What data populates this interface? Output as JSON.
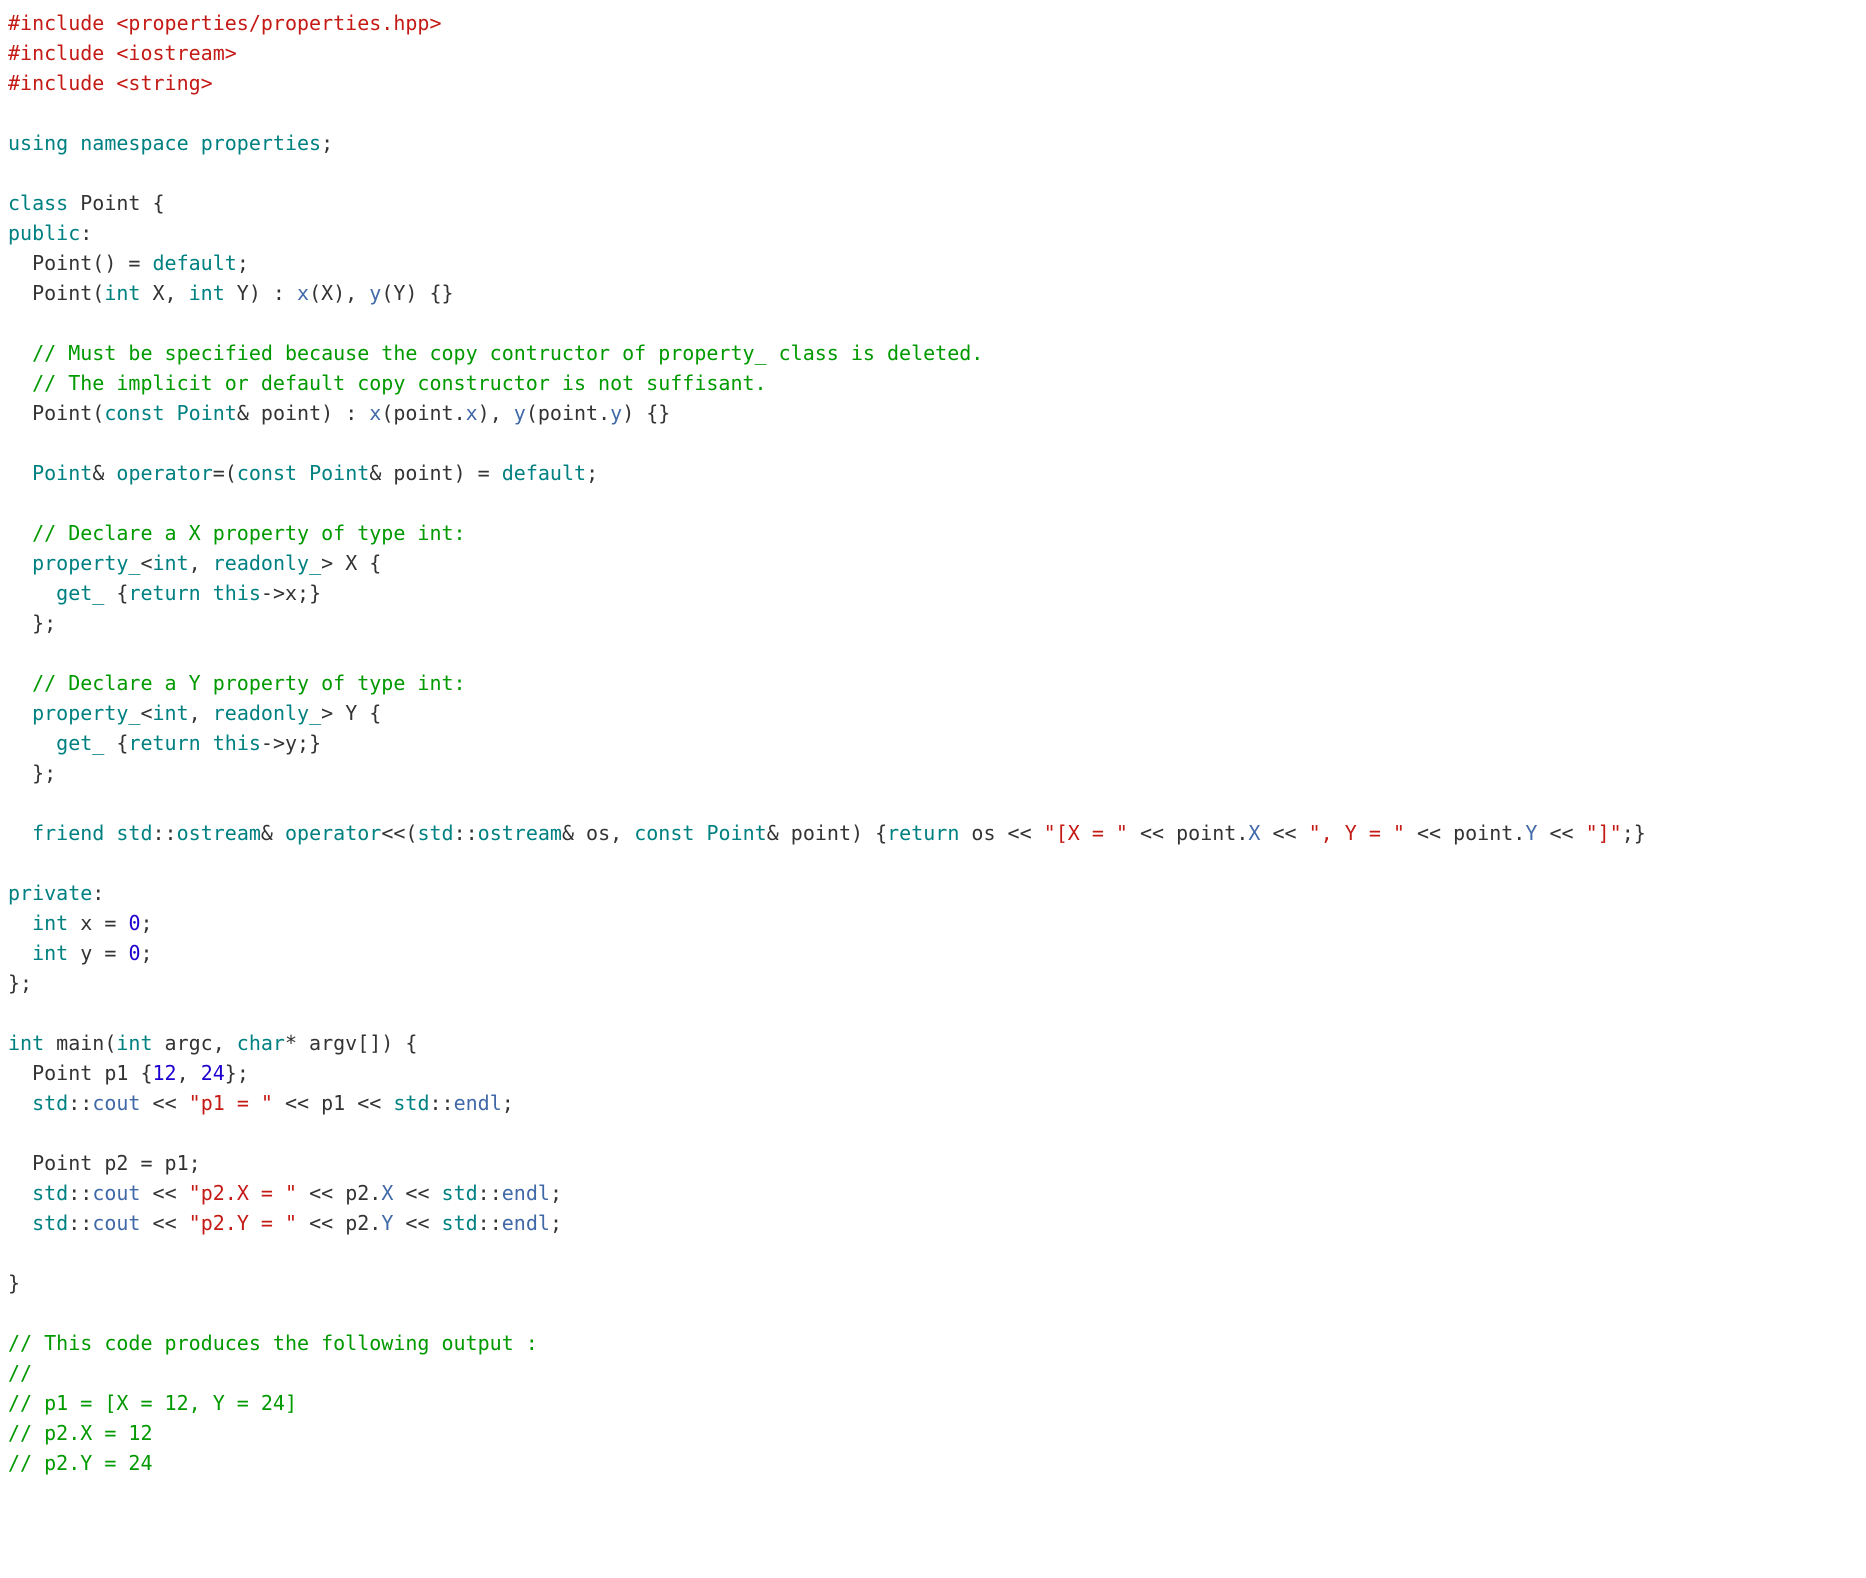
{
  "code_lines": [
    {
      "indent": 0,
      "tokens": [
        {
          "t": "#include ",
          "c": "preproc"
        },
        {
          "t": "<properties/properties.hpp>",
          "c": "preproc"
        }
      ]
    },
    {
      "indent": 0,
      "tokens": [
        {
          "t": "#include ",
          "c": "preproc"
        },
        {
          "t": "<iostream>",
          "c": "preproc"
        }
      ]
    },
    {
      "indent": 0,
      "tokens": [
        {
          "t": "#include ",
          "c": "preproc"
        },
        {
          "t": "<string>",
          "c": "preproc"
        }
      ]
    },
    {
      "indent": 0,
      "tokens": []
    },
    {
      "indent": 0,
      "tokens": [
        {
          "t": "using",
          "c": "keyword"
        },
        {
          "t": " ",
          "c": "plain"
        },
        {
          "t": "namespace",
          "c": "keyword"
        },
        {
          "t": " ",
          "c": "plain"
        },
        {
          "t": "properties",
          "c": "usertype"
        },
        {
          "t": ";",
          "c": "punct"
        }
      ]
    },
    {
      "indent": 0,
      "tokens": []
    },
    {
      "indent": 0,
      "tokens": [
        {
          "t": "class",
          "c": "keyword"
        },
        {
          "t": " ",
          "c": "plain"
        },
        {
          "t": "Point",
          "c": "plain"
        },
        {
          "t": " {",
          "c": "punct"
        }
      ]
    },
    {
      "indent": 0,
      "tokens": [
        {
          "t": "public",
          "c": "keyword"
        },
        {
          "t": ":",
          "c": "punct"
        }
      ]
    },
    {
      "indent": 1,
      "tokens": [
        {
          "t": "Point() = ",
          "c": "plain"
        },
        {
          "t": "default",
          "c": "keyword"
        },
        {
          "t": ";",
          "c": "punct"
        }
      ]
    },
    {
      "indent": 1,
      "tokens": [
        {
          "t": "Point(",
          "c": "plain"
        },
        {
          "t": "int",
          "c": "type"
        },
        {
          "t": " X, ",
          "c": "plain"
        },
        {
          "t": "int",
          "c": "type"
        },
        {
          "t": " Y) : ",
          "c": "plain"
        },
        {
          "t": "x",
          "c": "member"
        },
        {
          "t": "(X), ",
          "c": "plain"
        },
        {
          "t": "y",
          "c": "member"
        },
        {
          "t": "(Y) {}",
          "c": "plain"
        }
      ]
    },
    {
      "indent": 0,
      "tokens": []
    },
    {
      "indent": 1,
      "tokens": [
        {
          "t": "// Must be specified because the copy contructor of property_ class is deleted.",
          "c": "comment"
        }
      ]
    },
    {
      "indent": 1,
      "tokens": [
        {
          "t": "// The implicit or default copy constructor is not suffisant.",
          "c": "comment"
        }
      ]
    },
    {
      "indent": 1,
      "tokens": [
        {
          "t": "Point(",
          "c": "plain"
        },
        {
          "t": "const",
          "c": "keyword"
        },
        {
          "t": " ",
          "c": "plain"
        },
        {
          "t": "Point",
          "c": "usertype"
        },
        {
          "t": "& point) : ",
          "c": "plain"
        },
        {
          "t": "x",
          "c": "member"
        },
        {
          "t": "(point.",
          "c": "plain"
        },
        {
          "t": "x",
          "c": "member"
        },
        {
          "t": "), ",
          "c": "plain"
        },
        {
          "t": "y",
          "c": "member"
        },
        {
          "t": "(point.",
          "c": "plain"
        },
        {
          "t": "y",
          "c": "member"
        },
        {
          "t": ") {}",
          "c": "plain"
        }
      ]
    },
    {
      "indent": 0,
      "tokens": []
    },
    {
      "indent": 1,
      "tokens": [
        {
          "t": "Point",
          "c": "usertype"
        },
        {
          "t": "& ",
          "c": "plain"
        },
        {
          "t": "operator",
          "c": "keyword"
        },
        {
          "t": "=(",
          "c": "plain"
        },
        {
          "t": "const",
          "c": "keyword"
        },
        {
          "t": " ",
          "c": "plain"
        },
        {
          "t": "Point",
          "c": "usertype"
        },
        {
          "t": "& point) = ",
          "c": "plain"
        },
        {
          "t": "default",
          "c": "keyword"
        },
        {
          "t": ";",
          "c": "punct"
        }
      ]
    },
    {
      "indent": 0,
      "tokens": []
    },
    {
      "indent": 1,
      "tokens": [
        {
          "t": "// Declare a X property of type int:",
          "c": "comment"
        }
      ]
    },
    {
      "indent": 1,
      "tokens": [
        {
          "t": "property_",
          "c": "usertype"
        },
        {
          "t": "<",
          "c": "punct"
        },
        {
          "t": "int",
          "c": "type"
        },
        {
          "t": ", ",
          "c": "plain"
        },
        {
          "t": "readonly_",
          "c": "usertype"
        },
        {
          "t": "> X {",
          "c": "plain"
        }
      ]
    },
    {
      "indent": 2,
      "tokens": [
        {
          "t": "get_",
          "c": "usertype"
        },
        {
          "t": " {",
          "c": "plain"
        },
        {
          "t": "return",
          "c": "keyword"
        },
        {
          "t": " ",
          "c": "plain"
        },
        {
          "t": "this",
          "c": "keyword"
        },
        {
          "t": "->",
          "c": "plain"
        },
        {
          "t": "x",
          "c": "plain"
        },
        {
          "t": ";}",
          "c": "plain"
        }
      ]
    },
    {
      "indent": 1,
      "tokens": [
        {
          "t": "};",
          "c": "punct"
        }
      ]
    },
    {
      "indent": 0,
      "tokens": []
    },
    {
      "indent": 1,
      "tokens": [
        {
          "t": "// Declare a Y property of type int:",
          "c": "comment"
        }
      ]
    },
    {
      "indent": 1,
      "tokens": [
        {
          "t": "property_",
          "c": "usertype"
        },
        {
          "t": "<",
          "c": "punct"
        },
        {
          "t": "int",
          "c": "type"
        },
        {
          "t": ", ",
          "c": "plain"
        },
        {
          "t": "readonly_",
          "c": "usertype"
        },
        {
          "t": "> Y {",
          "c": "plain"
        }
      ]
    },
    {
      "indent": 2,
      "tokens": [
        {
          "t": "get_",
          "c": "usertype"
        },
        {
          "t": " {",
          "c": "plain"
        },
        {
          "t": "return",
          "c": "keyword"
        },
        {
          "t": " ",
          "c": "plain"
        },
        {
          "t": "this",
          "c": "keyword"
        },
        {
          "t": "->",
          "c": "plain"
        },
        {
          "t": "y",
          "c": "plain"
        },
        {
          "t": ";}",
          "c": "plain"
        }
      ]
    },
    {
      "indent": 1,
      "tokens": [
        {
          "t": "};",
          "c": "punct"
        }
      ]
    },
    {
      "indent": 0,
      "tokens": []
    },
    {
      "indent": 1,
      "tokens": [
        {
          "t": "friend",
          "c": "keyword"
        },
        {
          "t": " ",
          "c": "plain"
        },
        {
          "t": "std",
          "c": "usertype"
        },
        {
          "t": "::",
          "c": "plain"
        },
        {
          "t": "ostream",
          "c": "usertype"
        },
        {
          "t": "& ",
          "c": "plain"
        },
        {
          "t": "operator",
          "c": "keyword"
        },
        {
          "t": "<<(",
          "c": "plain"
        },
        {
          "t": "std",
          "c": "usertype"
        },
        {
          "t": "::",
          "c": "plain"
        },
        {
          "t": "ostream",
          "c": "usertype"
        },
        {
          "t": "& os, ",
          "c": "plain"
        },
        {
          "t": "const",
          "c": "keyword"
        },
        {
          "t": " ",
          "c": "plain"
        },
        {
          "t": "Point",
          "c": "usertype"
        },
        {
          "t": "& point) {",
          "c": "plain"
        },
        {
          "t": "return",
          "c": "keyword"
        },
        {
          "t": " os << ",
          "c": "plain"
        },
        {
          "t": "\"[X = \"",
          "c": "string"
        },
        {
          "t": " << point.",
          "c": "plain"
        },
        {
          "t": "X",
          "c": "member"
        },
        {
          "t": " << ",
          "c": "plain"
        },
        {
          "t": "\", Y = \"",
          "c": "string"
        },
        {
          "t": " << point.",
          "c": "plain"
        },
        {
          "t": "Y",
          "c": "member"
        },
        {
          "t": " << ",
          "c": "plain"
        },
        {
          "t": "\"]\"",
          "c": "string"
        },
        {
          "t": ";}",
          "c": "plain"
        }
      ]
    },
    {
      "indent": 0,
      "tokens": []
    },
    {
      "indent": 0,
      "tokens": [
        {
          "t": "private",
          "c": "keyword"
        },
        {
          "t": ":",
          "c": "punct"
        }
      ]
    },
    {
      "indent": 1,
      "tokens": [
        {
          "t": "int",
          "c": "type"
        },
        {
          "t": " x = ",
          "c": "plain"
        },
        {
          "t": "0",
          "c": "number"
        },
        {
          "t": ";",
          "c": "punct"
        }
      ]
    },
    {
      "indent": 1,
      "tokens": [
        {
          "t": "int",
          "c": "type"
        },
        {
          "t": " y = ",
          "c": "plain"
        },
        {
          "t": "0",
          "c": "number"
        },
        {
          "t": ";",
          "c": "punct"
        }
      ]
    },
    {
      "indent": 0,
      "tokens": [
        {
          "t": "};",
          "c": "punct"
        }
      ]
    },
    {
      "indent": 0,
      "tokens": []
    },
    {
      "indent": 0,
      "tokens": [
        {
          "t": "int",
          "c": "type"
        },
        {
          "t": " main(",
          "c": "plain"
        },
        {
          "t": "int",
          "c": "type"
        },
        {
          "t": " argc, ",
          "c": "plain"
        },
        {
          "t": "char",
          "c": "type"
        },
        {
          "t": "* argv[]) {",
          "c": "plain"
        }
      ]
    },
    {
      "indent": 1,
      "tokens": [
        {
          "t": "Point p1 {",
          "c": "plain"
        },
        {
          "t": "12",
          "c": "number"
        },
        {
          "t": ", ",
          "c": "plain"
        },
        {
          "t": "24",
          "c": "number"
        },
        {
          "t": "};",
          "c": "plain"
        }
      ]
    },
    {
      "indent": 1,
      "tokens": [
        {
          "t": "std",
          "c": "usertype"
        },
        {
          "t": "::",
          "c": "plain"
        },
        {
          "t": "cout",
          "c": "member"
        },
        {
          "t": " << ",
          "c": "plain"
        },
        {
          "t": "\"p1 = \"",
          "c": "string"
        },
        {
          "t": " << p1 << ",
          "c": "plain"
        },
        {
          "t": "std",
          "c": "usertype"
        },
        {
          "t": "::",
          "c": "plain"
        },
        {
          "t": "endl",
          "c": "member"
        },
        {
          "t": ";",
          "c": "punct"
        }
      ]
    },
    {
      "indent": 0,
      "tokens": []
    },
    {
      "indent": 1,
      "tokens": [
        {
          "t": "Point p2 = p1;",
          "c": "plain"
        }
      ]
    },
    {
      "indent": 1,
      "tokens": [
        {
          "t": "std",
          "c": "usertype"
        },
        {
          "t": "::",
          "c": "plain"
        },
        {
          "t": "cout",
          "c": "member"
        },
        {
          "t": " << ",
          "c": "plain"
        },
        {
          "t": "\"p2.X = \"",
          "c": "string"
        },
        {
          "t": " << p2.",
          "c": "plain"
        },
        {
          "t": "X",
          "c": "member"
        },
        {
          "t": " << ",
          "c": "plain"
        },
        {
          "t": "std",
          "c": "usertype"
        },
        {
          "t": "::",
          "c": "plain"
        },
        {
          "t": "endl",
          "c": "member"
        },
        {
          "t": ";",
          "c": "punct"
        }
      ]
    },
    {
      "indent": 1,
      "tokens": [
        {
          "t": "std",
          "c": "usertype"
        },
        {
          "t": "::",
          "c": "plain"
        },
        {
          "t": "cout",
          "c": "member"
        },
        {
          "t": " << ",
          "c": "plain"
        },
        {
          "t": "\"p2.Y = \"",
          "c": "string"
        },
        {
          "t": " << p2.",
          "c": "plain"
        },
        {
          "t": "Y",
          "c": "member"
        },
        {
          "t": " << ",
          "c": "plain"
        },
        {
          "t": "std",
          "c": "usertype"
        },
        {
          "t": "::",
          "c": "plain"
        },
        {
          "t": "endl",
          "c": "member"
        },
        {
          "t": ";",
          "c": "punct"
        }
      ]
    },
    {
      "indent": 0,
      "tokens": []
    },
    {
      "indent": 0,
      "tokens": [
        {
          "t": "}",
          "c": "punct"
        }
      ]
    },
    {
      "indent": 0,
      "tokens": []
    },
    {
      "indent": 0,
      "tokens": [
        {
          "t": "// This code produces the following output :",
          "c": "comment"
        }
      ]
    },
    {
      "indent": 0,
      "tokens": [
        {
          "t": "//",
          "c": "comment"
        }
      ]
    },
    {
      "indent": 0,
      "tokens": [
        {
          "t": "// p1 = [X = 12, Y = 24]",
          "c": "comment"
        }
      ]
    },
    {
      "indent": 0,
      "tokens": [
        {
          "t": "// p2.X = 12",
          "c": "comment"
        }
      ]
    },
    {
      "indent": 0,
      "tokens": [
        {
          "t": "// p2.Y = 24",
          "c": "comment"
        }
      ]
    }
  ]
}
